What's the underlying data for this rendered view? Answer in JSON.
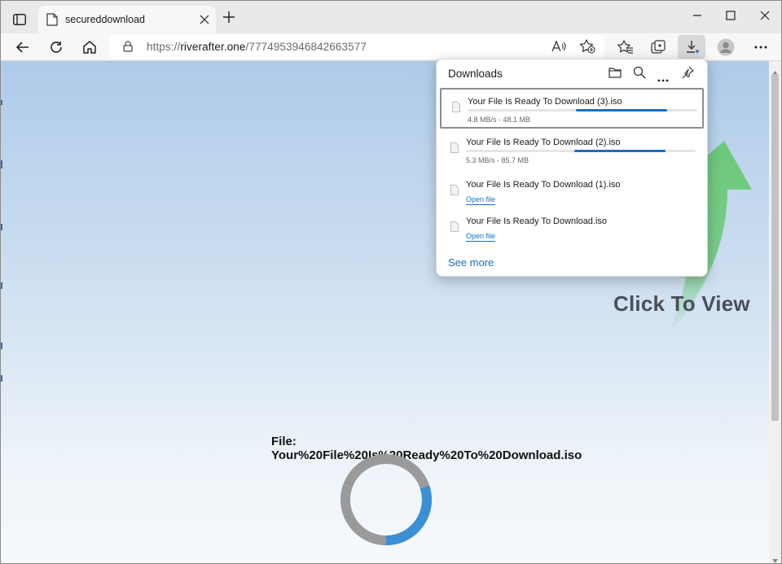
{
  "tab": {
    "title": "secureddownload",
    "favicon": "page-icon"
  },
  "address": {
    "scheme": "https://",
    "host": "riverafter.one",
    "path": "/7774953946842663577"
  },
  "toolbar_icons": [
    "back-icon",
    "refresh-icon",
    "home-icon",
    "read-aloud-icon",
    "add-favorite-icon",
    "favorites-icon",
    "collections-icon",
    "download-icon",
    "profile-icon",
    "more-icon"
  ],
  "downloads": {
    "title": "Downloads",
    "items": [
      {
        "name": "Your File Is Ready To Download (3).iso",
        "meta": "4.8 MB/s - 48.1 MB",
        "progress_start": 0.47,
        "progress_end": 0.87,
        "selected": true
      },
      {
        "name": "Your File Is Ready To Download (2).iso",
        "meta": "5.3 MB/s - 85.7 MB",
        "progress_start": 0.47,
        "progress_end": 0.87,
        "selected": false
      },
      {
        "name": "Your File Is Ready To Download (1).iso",
        "link": "Open file"
      },
      {
        "name": "Your File Is Ready To Download.iso",
        "link": "Open file"
      }
    ],
    "see_more": "See more"
  },
  "page": {
    "cta": "Click To View",
    "file_label_line1": "File:",
    "file_label_line2": "Your%20File%20Is%20Ready%20To%20Download.iso",
    "spinner_progress": 0.3
  },
  "colors": {
    "accent": "#1a6fc0",
    "spinner_track": "#9a9a9a",
    "spinner_fill": "#3a8fd6",
    "arrow": "#6cc97a"
  }
}
